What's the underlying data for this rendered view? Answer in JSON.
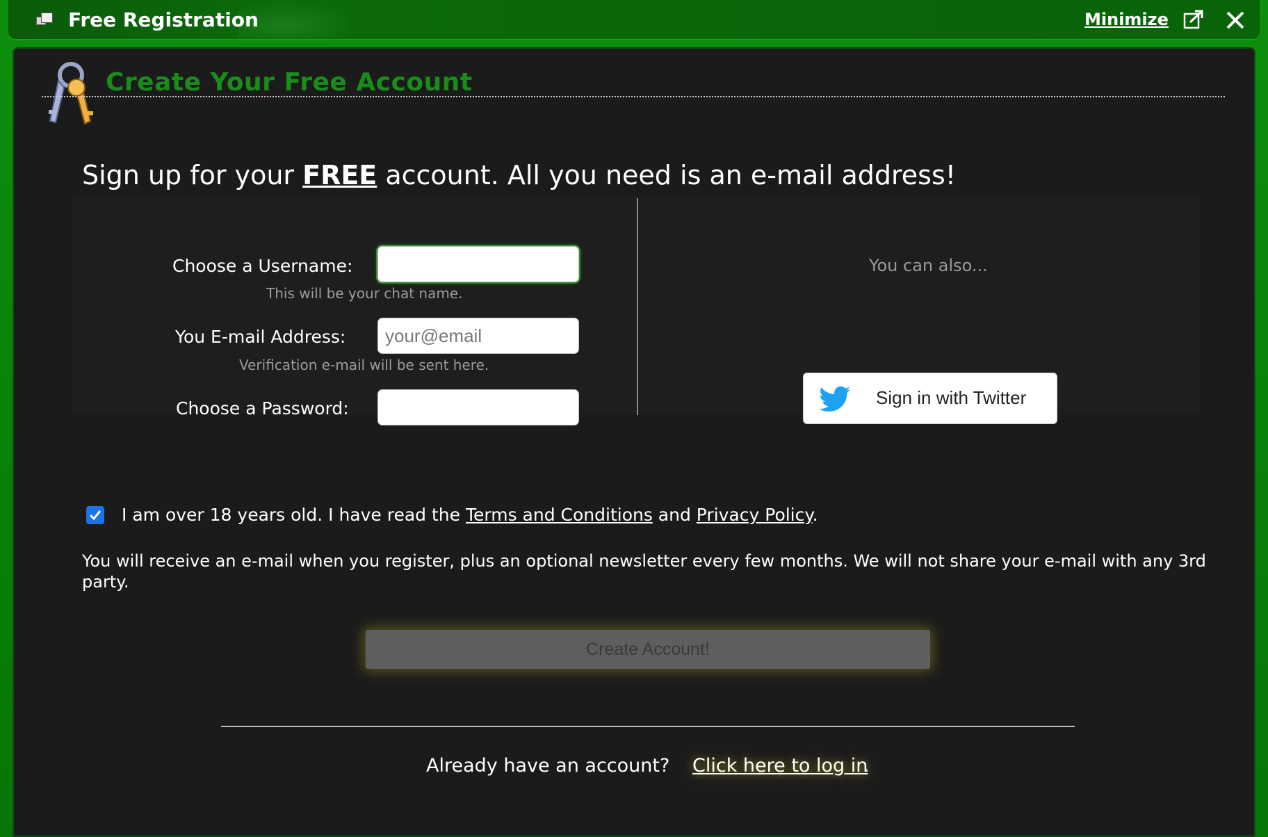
{
  "window": {
    "title": "Free Registration",
    "minimize_label": "Minimize",
    "popout_icon": "popout-icon",
    "close_icon": "close-icon"
  },
  "panel": {
    "heading": "Create Your Free Account",
    "heading_icon": "keys-icon",
    "intro": {
      "before": "Sign up for your ",
      "emphasis": "FREE",
      "after": " account.  All you need is an e-mail address!"
    }
  },
  "form": {
    "username": {
      "label": "Choose a Username:",
      "value": "",
      "placeholder": "",
      "hint": "This will be your chat name."
    },
    "email": {
      "label": "You E-mail Address:",
      "value": "",
      "placeholder": "your@email",
      "hint": "Verification e-mail will be sent here."
    },
    "password": {
      "label": "Choose a Password:",
      "value": "",
      "placeholder": ""
    }
  },
  "alternatives": {
    "text": "You can also...",
    "twitter_button": "Sign in with Twitter",
    "twitter_icon": "twitter-bird-icon"
  },
  "terms": {
    "checked": true,
    "before": "I am over 18 years old. I have read the ",
    "terms_link": "Terms and Conditions",
    "middle": " and ",
    "privacy_link": "Privacy Policy",
    "after": "."
  },
  "notice": "You will receive an e-mail when you register, plus an optional newsletter every few months. We will not share your e-mail with any 3rd party.",
  "create_button": "Create Account!",
  "login": {
    "prompt": "Already have an account?",
    "link": "Click here to log in",
    "period": "."
  },
  "colors": {
    "frame_green": "#0a7a0a",
    "heading_green": "#1a8c1a",
    "panel_bg": "#1b1b1b",
    "checkbox_blue": "#1a73e8"
  }
}
